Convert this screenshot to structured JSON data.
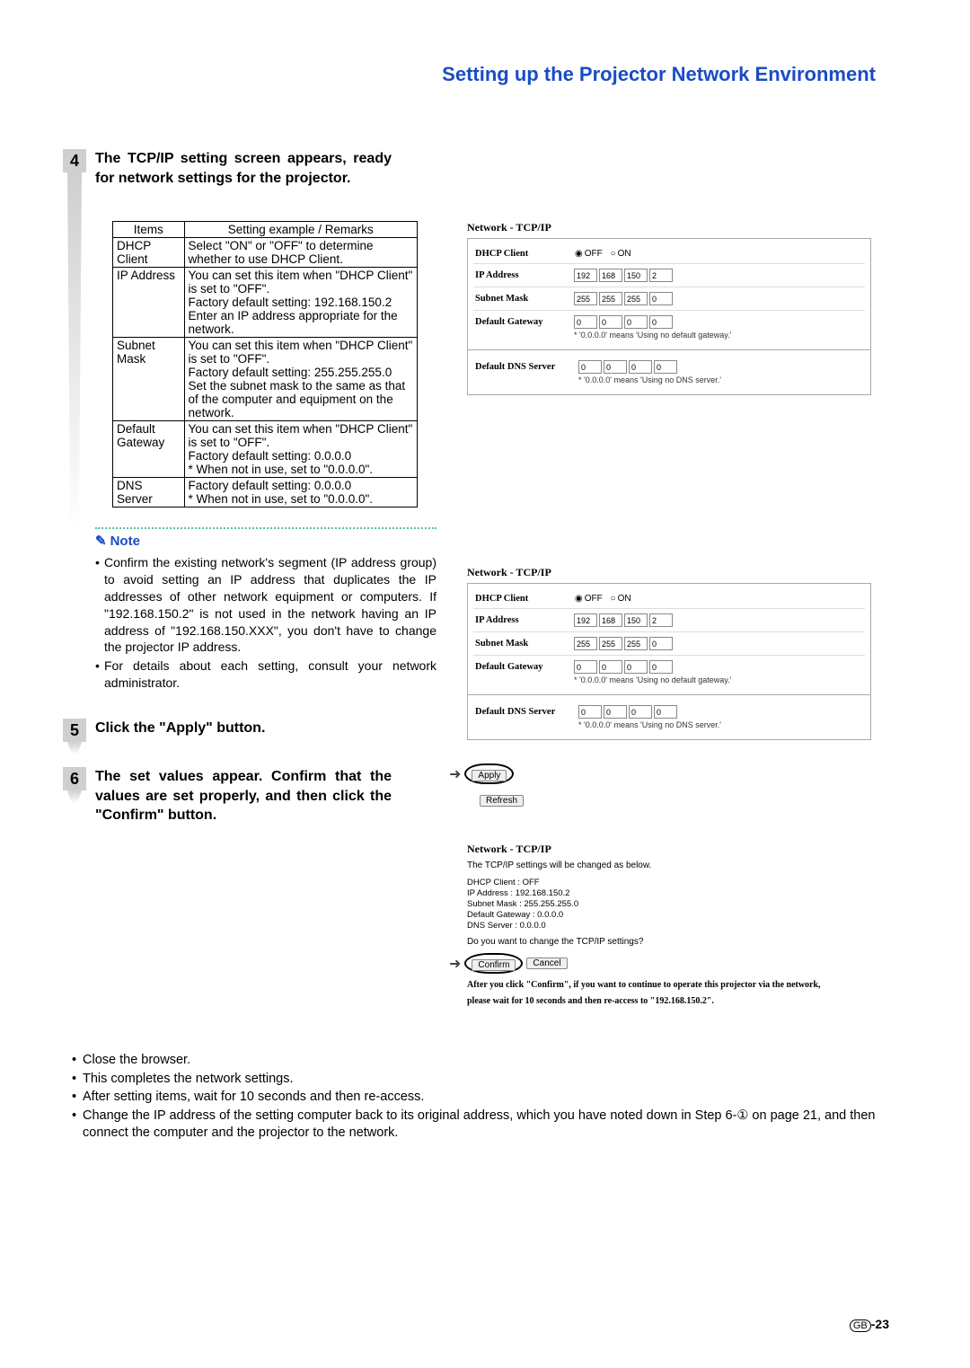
{
  "page_title": "Setting up the Projector Network Environment",
  "steps": {
    "4": {
      "num": "4",
      "heading": "The TCP/IP setting screen appears, ready for network settings for the projector.",
      "table_header_items": "Items",
      "table_header_remarks": "Setting example / Remarks",
      "rows": [
        {
          "item": "DHCP Client",
          "remarks": "Select \"ON\" or \"OFF\" to determine whether to use DHCP Client."
        },
        {
          "item": "IP Address",
          "remarks": "You can set this item when \"DHCP Client\" is set to \"OFF\".\nFactory default setting: 192.168.150.2\nEnter an IP address appropriate for the network."
        },
        {
          "item": "Subnet Mask",
          "remarks": "You can set this item when \"DHCP Client\" is set to \"OFF\".\nFactory default setting: 255.255.255.0\nSet the subnet mask to the same as that of the computer and equipment on the network."
        },
        {
          "item": "Default Gateway",
          "remarks": "You can set this item when \"DHCP Client\" is set to \"OFF\".\nFactory default setting: 0.0.0.0\n* When not in use, set to \"0.0.0.0\"."
        },
        {
          "item": "DNS Server",
          "remarks": "Factory default setting: 0.0.0.0\n* When not in use, set to \"0.0.0.0\"."
        }
      ]
    },
    "5": {
      "num": "5",
      "heading": "Click the \"Apply\" button."
    },
    "6": {
      "num": "6",
      "heading": "The set values appear. Confirm that the values are set properly, and then click the \"Confirm\" button."
    }
  },
  "note_label": "Note",
  "notes": [
    "Confirm the existing network's segment (IP address group) to avoid setting an IP address that duplicates the IP addresses of other network equipment or computers. If \"192.168.150.2\" is not used in the network having an IP address of \"192.168.150.XXX\", you don't have to change the projector IP address.",
    "For details about each setting, consult your network administrator."
  ],
  "network_panels": {
    "title": "Network - TCP/IP",
    "dhcp_label": "DHCP Client",
    "off_label": "OFF",
    "on_label": "ON",
    "ip_label": "IP Address",
    "ip": [
      "192",
      "168",
      "150",
      "2"
    ],
    "subnet_label": "Subnet Mask",
    "subnet": [
      "255",
      "255",
      "255",
      "0"
    ],
    "gateway_label": "Default Gateway",
    "gateway": [
      "0",
      "0",
      "0",
      "0"
    ],
    "gateway_note": "* '0.0.0.0' means 'Using no default gateway.'",
    "dns_label": "Default DNS Server",
    "dns": [
      "0",
      "0",
      "0",
      "0"
    ],
    "dns_note": "* '0.0.0.0' means 'Using no DNS server.'",
    "apply_btn": "Apply",
    "refresh_btn": "Refresh"
  },
  "confirm_panel": {
    "title": "Network - TCP/IP",
    "intro": "The TCP/IP settings will be changed as below.",
    "items": [
      "DHCP Client   : OFF",
      "IP Address    : 192.168.150.2",
      "Subnet Mask   : 255.255.255.0",
      "Default Gateway : 0.0.0.0",
      "DNS Server    : 0.0.0.0"
    ],
    "question": "Do you want to change the TCP/IP settings?",
    "confirm_btn": "Confirm",
    "cancel_btn": "Cancel",
    "after1": "After you click \"Confirm\", if you want to continue to operate this projector via the network,",
    "after2": "please wait for 10 seconds and then re-access to \"192.168.150.2\"."
  },
  "bottom_notes": [
    "Close the browser.",
    "This completes the network settings.",
    "After setting items, wait for 10 seconds and then re-access.",
    "Change the IP address of the setting computer back to its original address, which you have noted down in Step 6-① on page 21, and then connect the computer and the projector to the network."
  ],
  "page_num_prefix": "GB",
  "page_num": "-23"
}
